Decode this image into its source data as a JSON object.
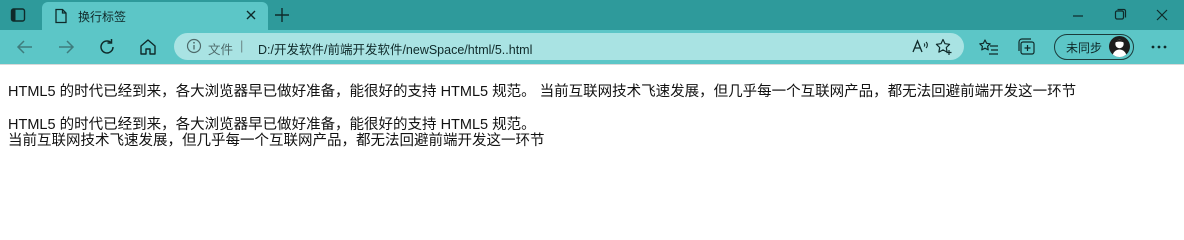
{
  "tab": {
    "title": "换行标签"
  },
  "address_bar": {
    "scheme_label": "文件",
    "separator": "|",
    "url": "D:/开发软件/前端开发软件/newSpace/html/5..html"
  },
  "profile": {
    "label": "未同步"
  },
  "content": {
    "paragraph_1": "HTML5 的时代已经到来，各大浏览器早已做好准备，能很好的支持 HTML5 规范。 当前互联网技术飞速发展，但几乎每一个互联网产品，都无法回避前端开发这一环节",
    "paragraph_2_line_1": "HTML5 的时代已经到来，各大浏览器早已做好准备，能很好的支持 HTML5 规范。",
    "paragraph_2_line_2": "当前互联网技术飞速发展，但几乎每一个互联网产品，都无法回避前端开发这一环节"
  },
  "icons": {
    "tab_actions": "tab-actions-icon",
    "page": "page-icon",
    "close": "close-icon",
    "new_tab": "plus-icon",
    "minimize": "minimize-icon",
    "restore": "restore-icon",
    "window_close": "window-close-icon",
    "back": "back-arrow-icon",
    "forward": "forward-arrow-icon",
    "refresh": "refresh-icon",
    "home": "home-icon",
    "info": "info-icon",
    "read_aloud": "read-aloud-icon",
    "favorite_add": "add-favorite-icon",
    "favorites": "favorites-icon",
    "collections": "collections-icon",
    "more": "more-icon"
  },
  "colors": {
    "tab_strip": "#2e9a9b",
    "toolbar": "#5cc6c7",
    "address_bar": "#a9e3e3"
  }
}
